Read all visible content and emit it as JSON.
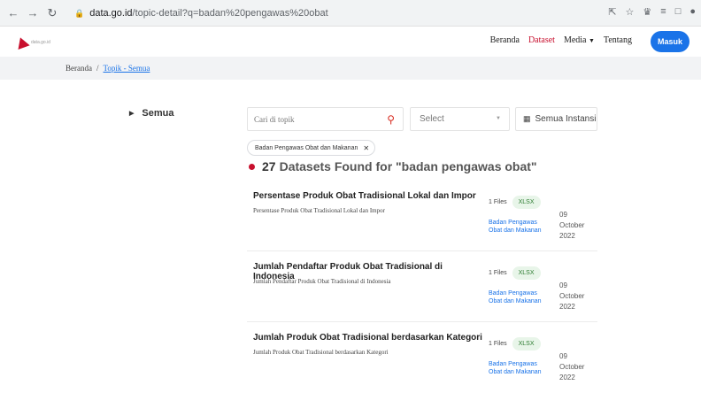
{
  "browser": {
    "url_host": "data.go.id",
    "url_rest": "/topic-detail?q=badan%20pengawas%20obat"
  },
  "header": {
    "logo_text": "data.go.id",
    "nav": [
      "Beranda",
      "Dataset",
      "Media",
      "Tentang"
    ],
    "login_label": "Masuk"
  },
  "breadcrumb": {
    "home": "Beranda",
    "separator": "/",
    "current": "Topik - Semua"
  },
  "sidebar": {
    "category": "Semua"
  },
  "filters": {
    "search_placeholder": "Cari di topik",
    "select_label": "Select",
    "instansi_label": "Semua Instansi",
    "chip_label": "Badan Pengawas Obat dan Makanan"
  },
  "results": {
    "count": "27",
    "text": "Datasets Found for \"badan pengawas obat\""
  },
  "datasets": [
    {
      "title": "Persentase Produk Obat Tradisional Lokal dan Impor",
      "description": "Persentase Produk Obat Tradisional Lokal dan Impor",
      "files": "1 Files",
      "format": "XLSX",
      "org": "Badan Pengawas Obat dan Makanan",
      "day": "09",
      "month": "October",
      "year": "2022"
    },
    {
      "title": "Jumlah Pendaftar Produk Obat Tradisional di Indonesia",
      "description": "Jumlah Pendaftar Produk Obat Tradisional di Indonesia",
      "files": "1 Files",
      "format": "XLSX",
      "org": "Badan Pengawas Obat dan Makanan",
      "day": "09",
      "month": "October",
      "year": "2022"
    },
    {
      "title": "Jumlah Produk Obat Tradisional berdasarkan Kategori",
      "description": "Jumlah Produk Obat Tradisional berdasarkan Kategori",
      "files": "1 Files",
      "format": "XLSX",
      "org": "Badan Pengawas Obat dan Makanan",
      "day": "09",
      "month": "October",
      "year": "2022"
    }
  ],
  "colors": {
    "brand_red": "#c8102e",
    "link_blue": "#1a73e8",
    "format_green": "#2e7d32"
  }
}
